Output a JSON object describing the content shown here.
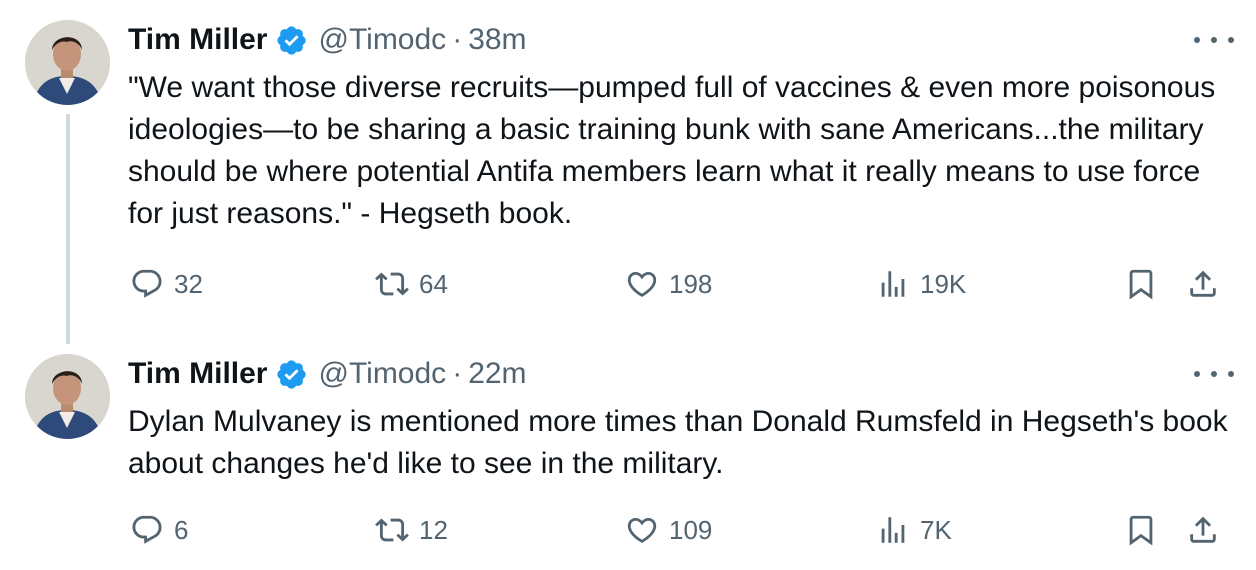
{
  "tweets": [
    {
      "author_name": "Tim Miller",
      "handle": "@Timodc",
      "separator": "·",
      "time": "38m",
      "text": "\"We want those diverse recruits—pumped full of vaccines & even more poisonous ideologies—to be sharing a basic training bunk with sane Americans...the military should be where potential Antifa members learn what it really means to use force for just reasons.\" - Hegseth book.",
      "replies": "32",
      "retweets": "64",
      "likes": "198",
      "views": "19K"
    },
    {
      "author_name": "Tim Miller",
      "handle": "@Timodc",
      "separator": "·",
      "time": "22m",
      "text": "Dylan Mulvaney is mentioned more times than Donald Rumsfeld in Hegseth's book about changes he'd like to see in the military.",
      "replies": "6",
      "retweets": "12",
      "likes": "109",
      "views": "7K"
    }
  ],
  "icons": {
    "verified": "verified-badge-icon",
    "more": "more-dots-icon",
    "reply": "reply-icon",
    "retweet": "retweet-icon",
    "like": "heart-icon",
    "views": "views-bar-icon",
    "bookmark": "bookmark-icon",
    "share": "share-icon"
  },
  "colors": {
    "text_primary": "#0f1419",
    "text_secondary": "#536471",
    "verified_blue": "#1d9bf0",
    "thread_line": "#cfd9de"
  }
}
